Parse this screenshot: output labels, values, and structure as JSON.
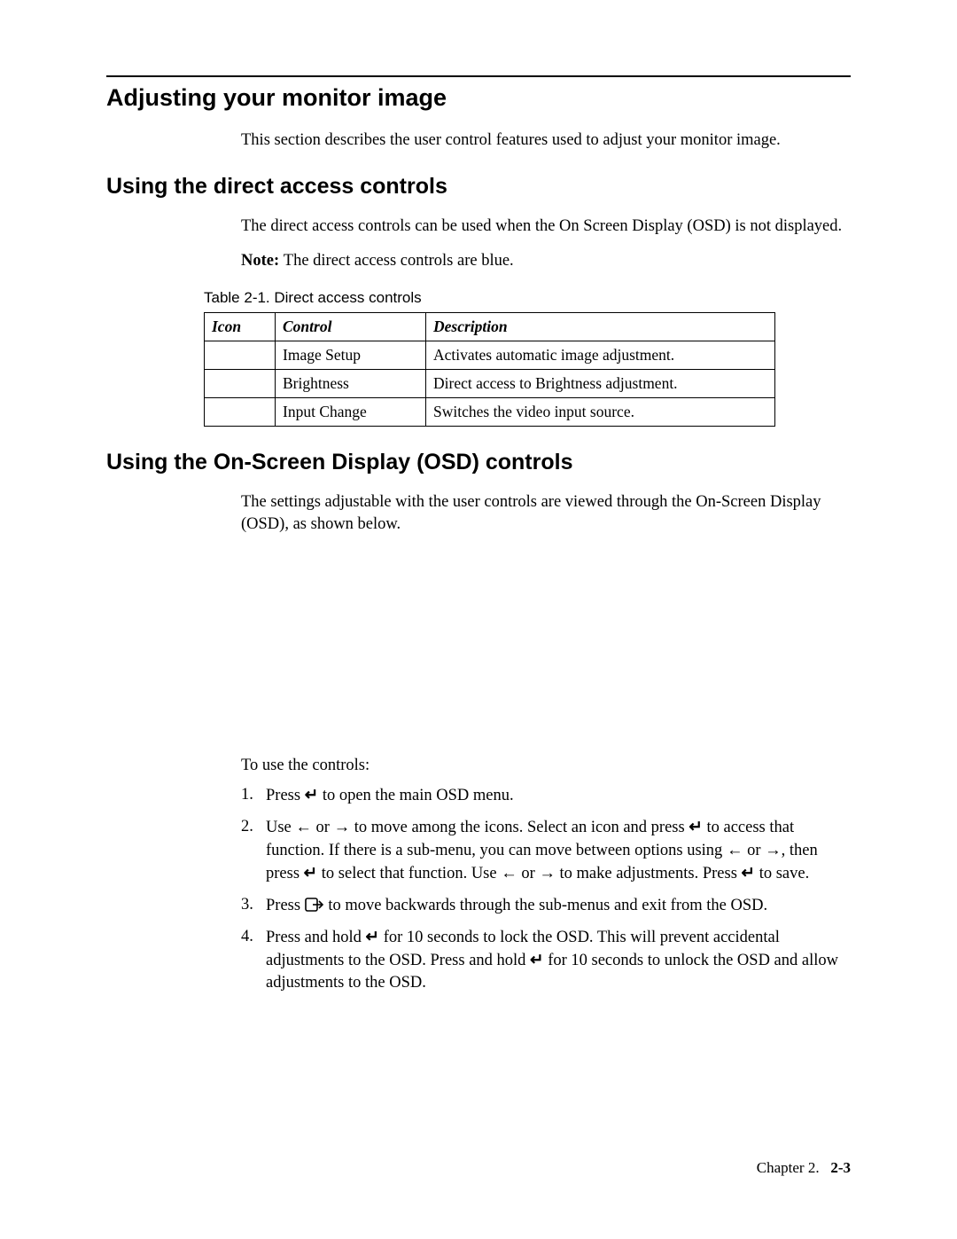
{
  "headings": {
    "h1": "Adjusting your monitor image",
    "h2a": "Using the direct access controls",
    "h2b": "Using the On-Screen Display (OSD) controls"
  },
  "intro_para": "This section describes the user control features used to adjust your monitor image.",
  "direct_access_para": "The direct access controls can be used when the On Screen Display (OSD) is not displayed.",
  "note_label": "Note: ",
  "note_text": "The direct access controls are blue.",
  "table_caption": "Table 2-1. Direct access controls",
  "table": {
    "headers": {
      "icon": "Icon",
      "control": "Control",
      "description": "Description"
    },
    "rows": [
      {
        "control": "Image Setup",
        "description": "Activates automatic image adjustment."
      },
      {
        "control": "Brightness",
        "description": "Direct access to Brightness adjustment."
      },
      {
        "control": "Input Change",
        "description": "Switches the video input source."
      }
    ]
  },
  "osd_para": "The settings adjustable with the user controls are viewed through the On-Screen Display (OSD), as shown below.",
  "list_intro": "To use the controls:",
  "steps": {
    "s1_a": "Press ",
    "s1_b": " to open the main OSD menu.",
    "s2_a": "Use ",
    "s2_b": " or ",
    "s2_c": " to move among the icons. Select an icon and press ",
    "s2_d": " to access that function. If there is a sub-menu, you can move between options using ",
    "s2_e": " or ",
    "s2_f": ", then press ",
    "s2_g": " to select that function. Use ",
    "s2_h": " or ",
    "s2_i": " to make adjustments. Press ",
    "s2_j": " to save.",
    "s3_a": "Press ",
    "s3_b": " to move backwards through the sub-menus and exit from the OSD.",
    "s4_a": "Press and hold ",
    "s4_b": " for 10 seconds to lock the OSD. This will prevent accidental adjustments to the OSD. Press and hold ",
    "s4_c": " for 10  seconds to unlock the OSD and allow adjustments to the OSD."
  },
  "glyphs": {
    "enter": "↵",
    "left": "←",
    "right": "→"
  },
  "footer": {
    "chapter": "Chapter 2.",
    "page": "2-3"
  }
}
